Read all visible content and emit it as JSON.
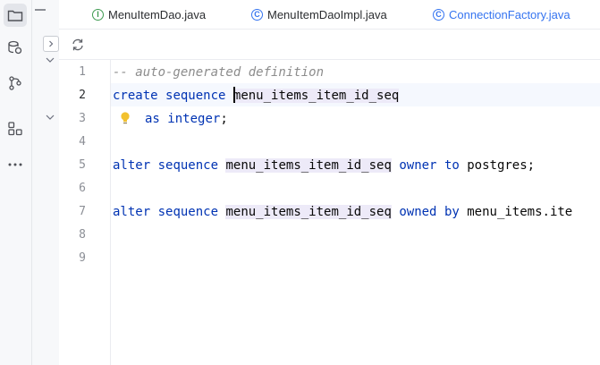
{
  "tabs": [
    {
      "label": "MenuItemDao.java",
      "icon": "interface-icon",
      "badge": "I"
    },
    {
      "label": "MenuItemDaoImpl.java",
      "icon": "class-icon",
      "badge": "C"
    },
    {
      "label": "ConnectionFactory.java",
      "icon": "class-icon",
      "badge": "C"
    }
  ],
  "line_numbers": [
    "1",
    "2",
    "3",
    "4",
    "5",
    "6",
    "7",
    "8",
    "9"
  ],
  "current_line": 2,
  "code": {
    "line1": {
      "comment": "-- auto-generated definition"
    },
    "line2": {
      "kw1": "create",
      "kw2": "sequence",
      "ident": "menu_items_item_id_seq"
    },
    "line3": {
      "kw1": "as",
      "kw2": "integer",
      "punct": ";"
    },
    "line5": {
      "kw1": "alter",
      "kw2": "sequence",
      "ident": "menu_items_item_id_seq",
      "kw3": "owner",
      "kw4": "to",
      "text": "postgres;"
    },
    "line7": {
      "kw1": "alter",
      "kw2": "sequence",
      "ident": "menu_items_item_id_seq",
      "kw3": "owned",
      "kw4": "by",
      "text": "menu_items.ite"
    }
  },
  "colors": {
    "keyword": "#0033b3",
    "comment": "#8c8c8c",
    "identifier_highlight": "#edeaf8",
    "selected_tab_text": "#3574f0"
  }
}
